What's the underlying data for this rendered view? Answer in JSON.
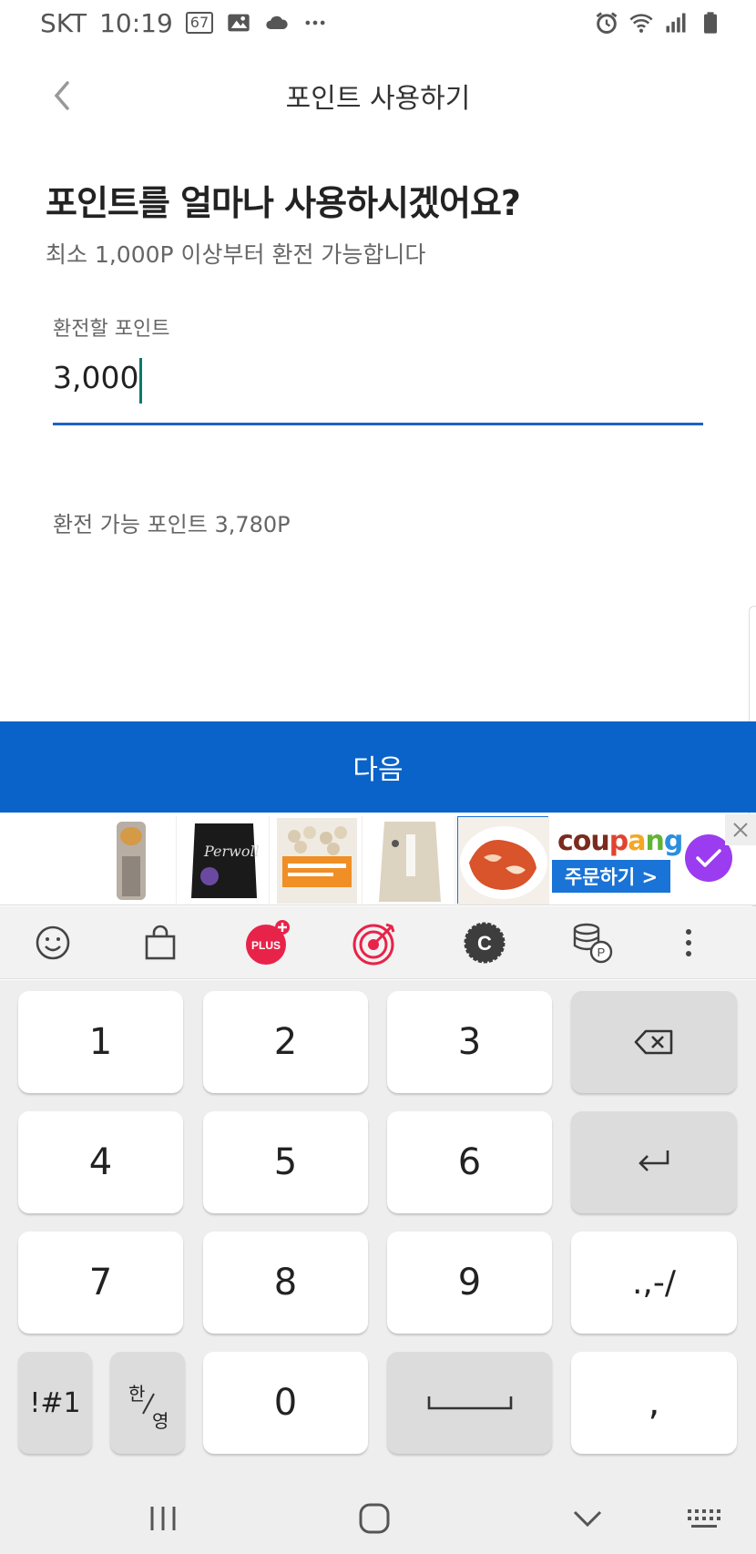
{
  "status_bar": {
    "carrier": "SKT",
    "time": "10:19",
    "notification_badge": "67",
    "icons_left": [
      "image-icon",
      "cloud-icon",
      "more-dots-icon"
    ],
    "icons_right": [
      "alarm-icon",
      "wifi-icon",
      "signal-icon",
      "battery-icon"
    ]
  },
  "header": {
    "title": "포인트 사용하기",
    "back_icon": "chevron-left-icon"
  },
  "content": {
    "question": "포인트를 얼마나 사용하시겠어요?",
    "subtext": "최소 1,000P 이상부터 환전 가능합니다",
    "field_label": "환전할 포인트",
    "field_value": "3,000",
    "available": "환전 가능 포인트 3,780P"
  },
  "next_button": {
    "label": "다음"
  },
  "ad": {
    "logo": "coupang",
    "cta": "주문하기 >",
    "thumbnails": 5
  },
  "keyboard_toolbar": {
    "icons": [
      "emoji-icon",
      "shopping-bag-icon",
      "plus-icon",
      "target-icon",
      "c-coin-icon",
      "point-coins-icon",
      "more-vertical-icon"
    ],
    "plus_label": "PLUS",
    "c_label": "C",
    "p_label": "P"
  },
  "keys": {
    "k1": "1",
    "k2": "2",
    "k3": "3",
    "k4": "4",
    "k5": "5",
    "k6": "6",
    "k7": "7",
    "k8": "8",
    "k9": "9",
    "k0": "0",
    "punct": ".,-/",
    "symbols": "!#1",
    "lang_top": "한",
    "lang_bottom": "영",
    "comma": ","
  },
  "colors": {
    "primary": "#0a63c9",
    "underline": "#1c63c2",
    "caret": "#0b7a6b",
    "plus_red": "#e8234a",
    "check_purple": "#9b3cf0"
  }
}
